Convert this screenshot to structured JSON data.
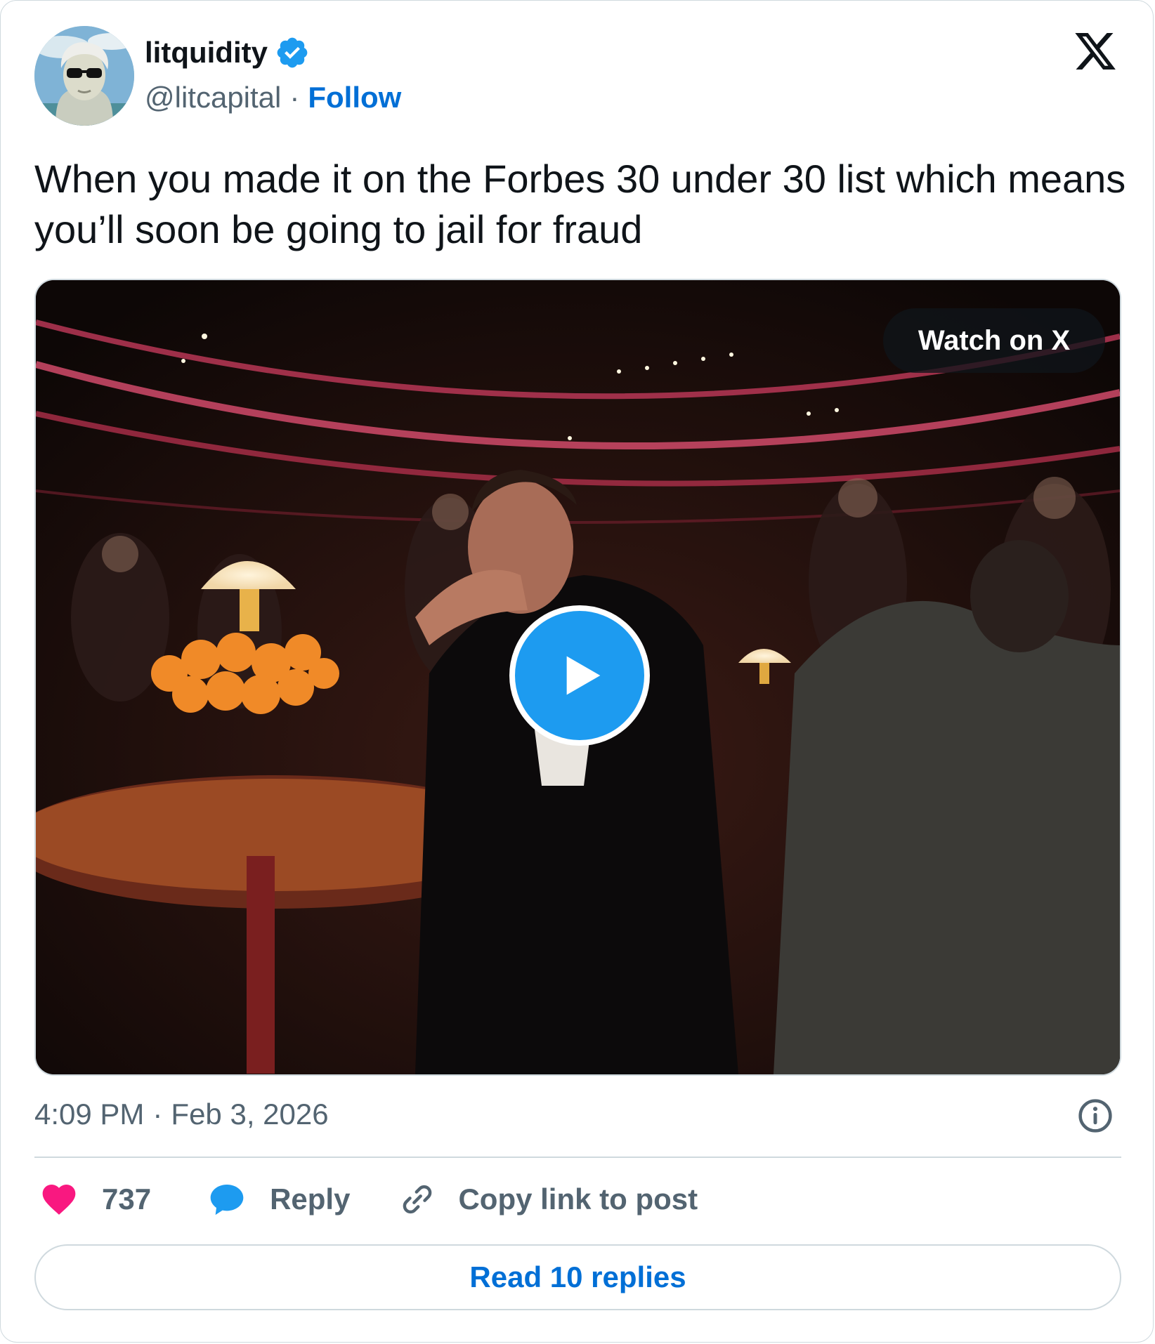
{
  "author": {
    "name": "litquidity",
    "handle": "@litcapital",
    "separator": "·",
    "follow_label": "Follow",
    "verified": true,
    "avatar_icon": "avatar-icon"
  },
  "platform_icon": "x-logo-icon",
  "tweet": {
    "text": "When you made it on the Forbes 30 under 30 list which means you’ll soon be going to jail for fraud"
  },
  "media": {
    "type": "video",
    "watch_label": "Watch on X",
    "play_icon": "play-icon"
  },
  "meta": {
    "time": "4:09 PM",
    "separator": "·",
    "date": "Feb 3, 2026",
    "info_icon": "info-icon"
  },
  "actions": {
    "likes": "737",
    "reply_label": "Reply",
    "copy_label": "Copy link to post"
  },
  "footer": {
    "read_replies_label": "Read 10 replies"
  },
  "colors": {
    "link": "#006fd6",
    "verified": "#1d9bf0",
    "like": "#f91880",
    "reply": "#1d9bf0",
    "muted": "#536471",
    "border": "#cfd9de"
  }
}
